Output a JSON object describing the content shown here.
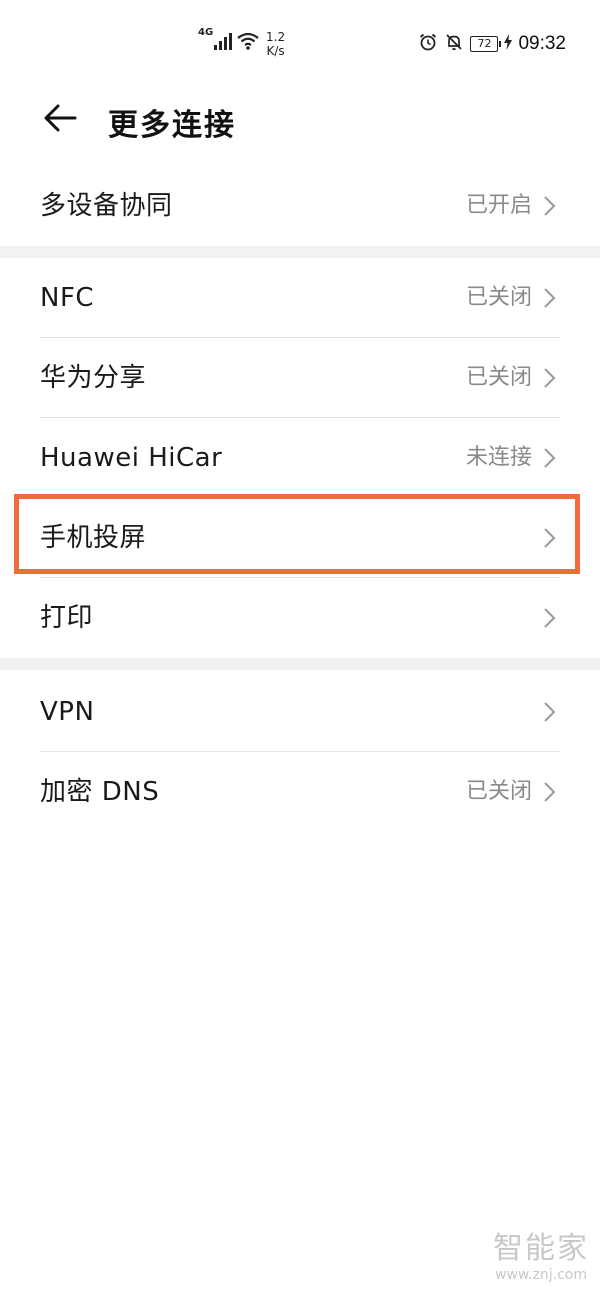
{
  "status_bar": {
    "network_type": "4G",
    "speed_value": "1.2",
    "speed_unit": "K/s",
    "battery": "72",
    "time": "09:32"
  },
  "header": {
    "title": "更多连接"
  },
  "sections": [
    {
      "items": [
        {
          "label": "多设备协同",
          "status": "已开启"
        }
      ]
    },
    {
      "items": [
        {
          "label": "NFC",
          "status": "已关闭"
        },
        {
          "label": "华为分享",
          "status": "已关闭"
        },
        {
          "label": "Huawei HiCar",
          "status": "未连接"
        },
        {
          "label": "手机投屏",
          "status": ""
        },
        {
          "label": "打印",
          "status": ""
        }
      ]
    },
    {
      "items": [
        {
          "label": "VPN",
          "status": ""
        },
        {
          "label": "加密 DNS",
          "status": "已关闭"
        }
      ]
    }
  ],
  "highlight": {
    "target": "手机投屏",
    "color": "#f26b3a"
  },
  "watermark": {
    "name": "智能家",
    "url": "www.znj.com"
  }
}
